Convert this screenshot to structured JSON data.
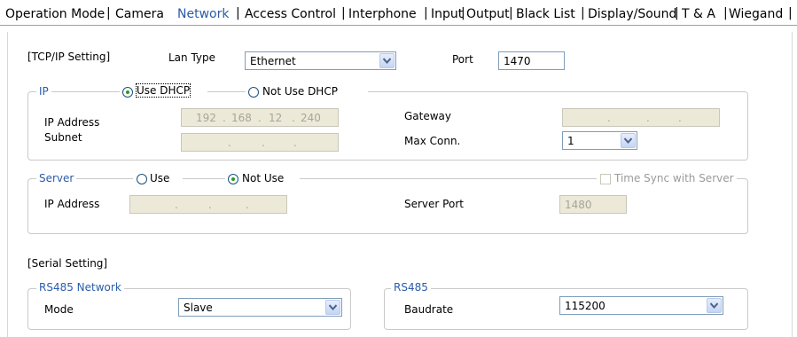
{
  "tabs": [
    "Operation Mode",
    "Camera",
    "Network",
    "Access Control",
    "Interphone",
    "Input",
    "Output",
    "Black List",
    "Display/Sound",
    "T & A",
    "Wiegand"
  ],
  "active_tab": "Network",
  "tcpip": {
    "title": "[TCP/IP Setting]",
    "lan_type_label": "Lan Type",
    "lan_type_value": "Ethernet",
    "port_label": "Port",
    "port_value": "1470"
  },
  "ip_group": {
    "legend": "IP",
    "use_dhcp": "Use DHCP",
    "not_use_dhcp": "Not Use DHCP",
    "ip_address_label": "IP Address",
    "ip_address_value": [
      "192",
      "168",
      "12",
      "240"
    ],
    "subnet_label": "Subnet",
    "gateway_label": "Gateway",
    "max_conn_label": "Max Conn.",
    "max_conn_value": "1"
  },
  "server_group": {
    "legend": "Server",
    "use": "Use",
    "not_use": "Not Use",
    "time_sync": "Time Sync with Server",
    "ip_address_label": "IP Address",
    "server_port_label": "Server Port",
    "server_port_value": "1480"
  },
  "serial": {
    "title": "[Serial Setting]",
    "rs485_network_legend": "RS485 Network",
    "mode_label": "Mode",
    "mode_value": "Slave",
    "rs485_legend": "RS485",
    "baudrate_label": "Baudrate",
    "baudrate_value": "115200"
  },
  "ip_dot": "."
}
